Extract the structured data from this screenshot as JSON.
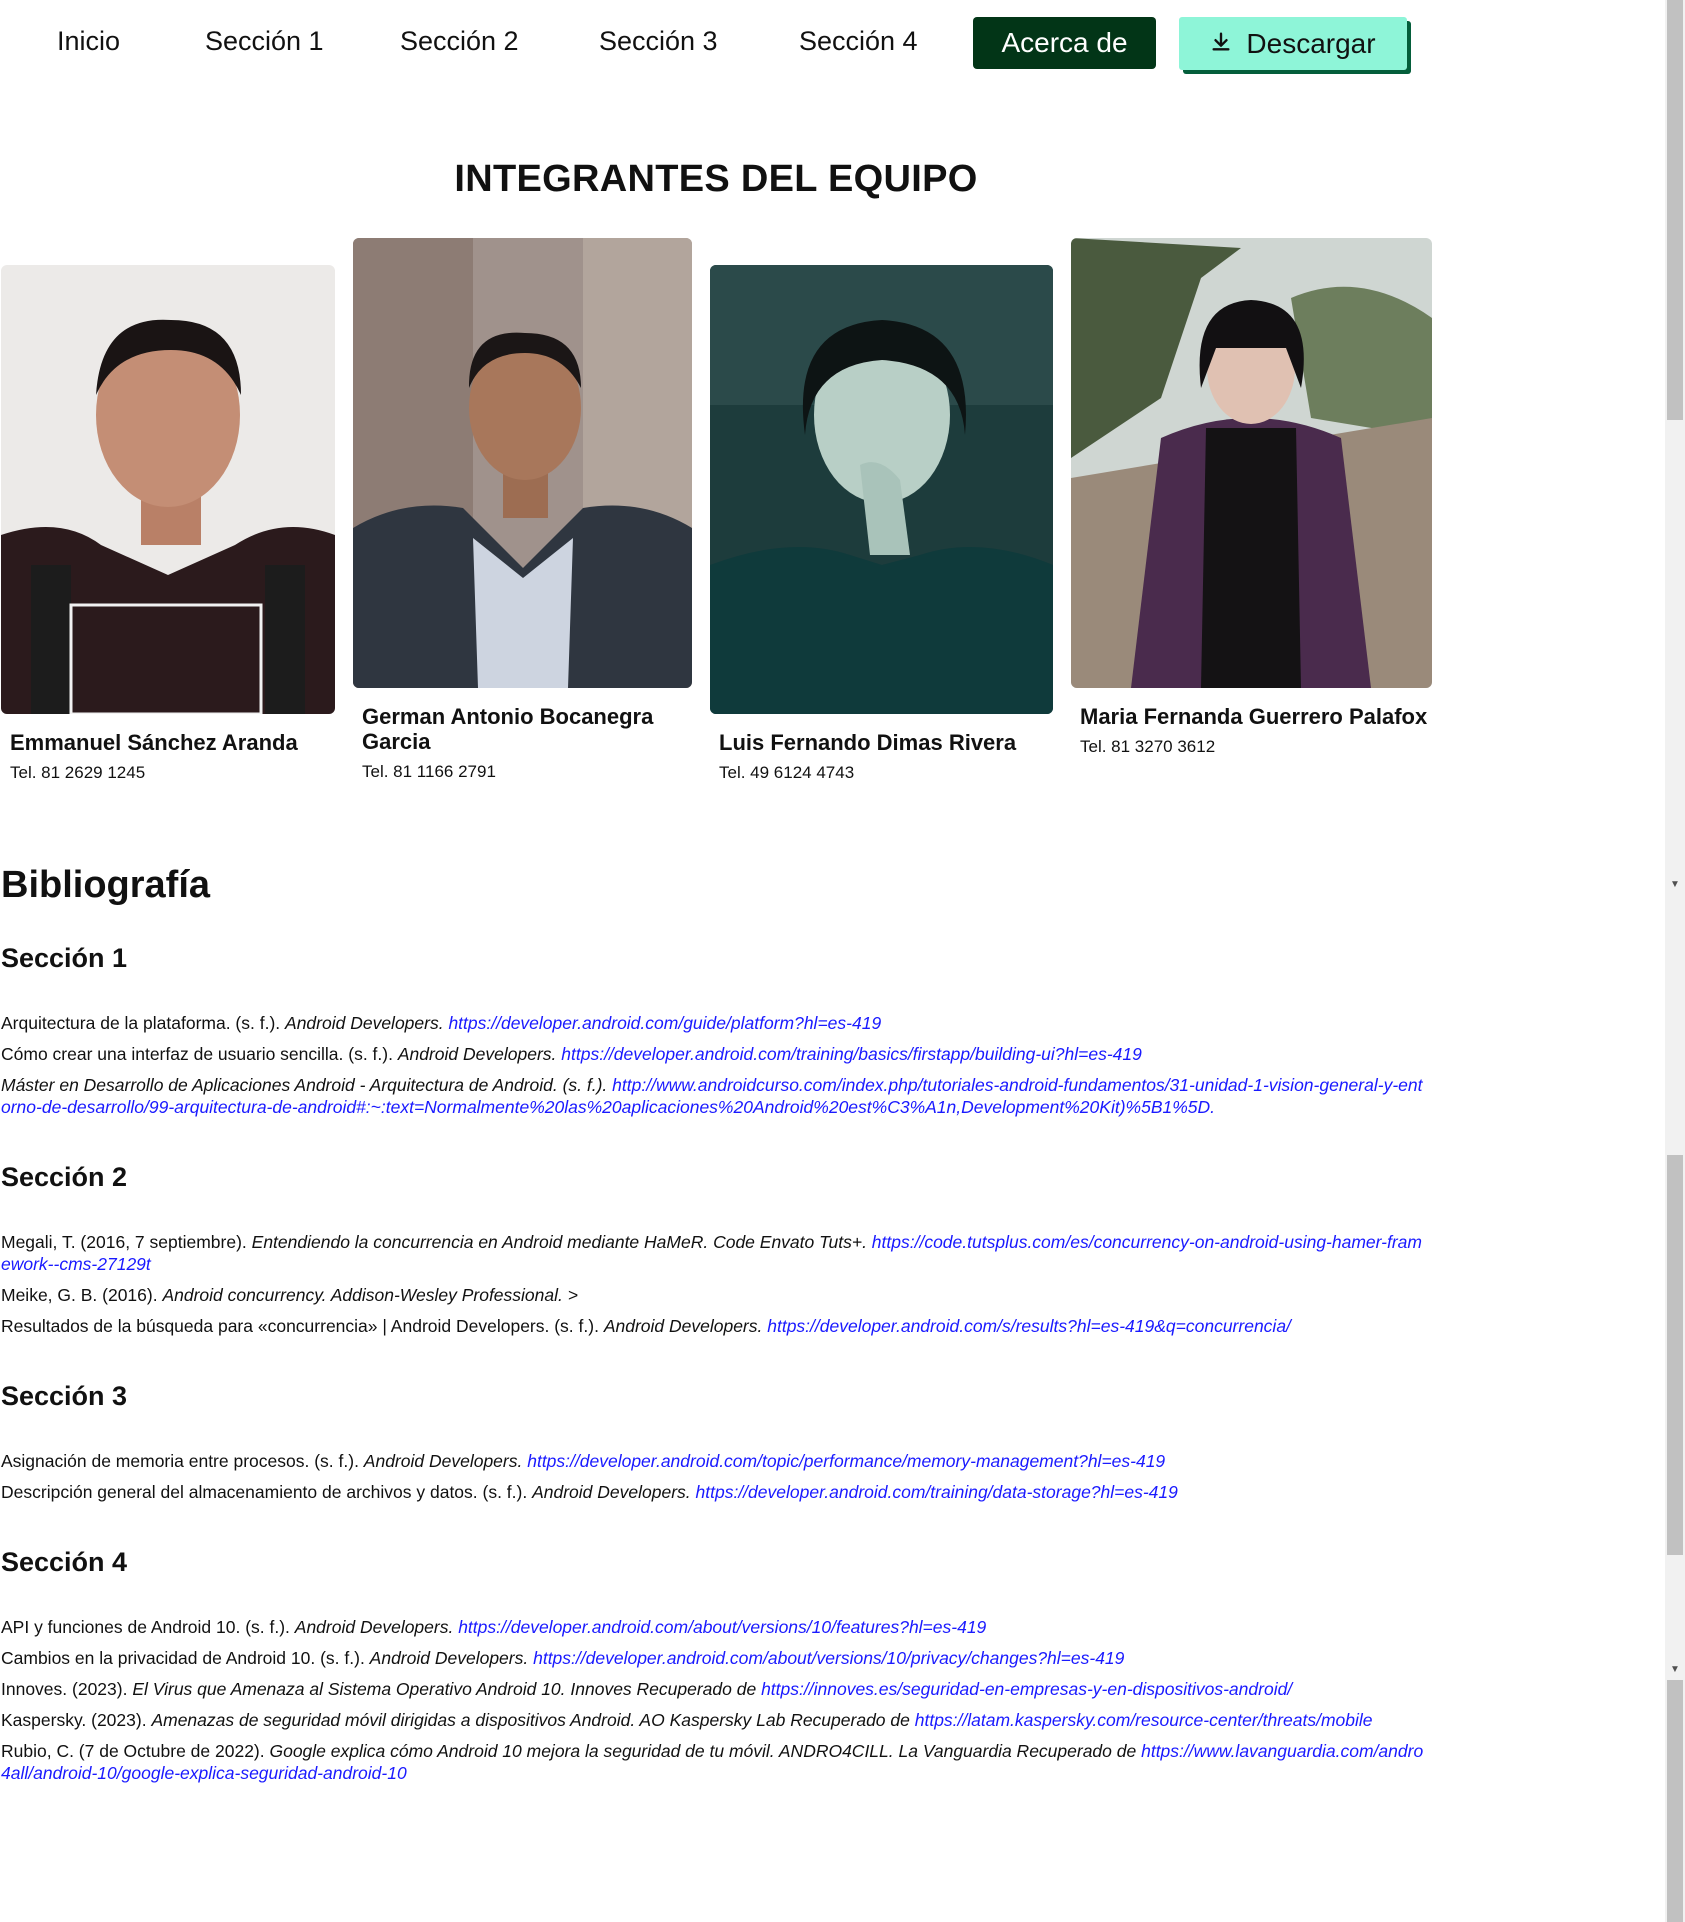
{
  "nav": {
    "links": [
      "Inicio",
      "Sección 1",
      "Sección 2",
      "Sección 3",
      "Sección 4"
    ],
    "about": "Acerca de",
    "download": "Descargar"
  },
  "team": {
    "title": "INTEGRANTES DEL EQUIPO",
    "members": [
      {
        "name": "Emmanuel Sánchez Aranda",
        "tel": "Tel. 81 2629 1245"
      },
      {
        "name": "German Antonio Bocanegra Garcia",
        "tel": "Tel. 81 1166 2791"
      },
      {
        "name": "Luis Fernando Dimas Rivera",
        "tel": "Tel. 49 6124 4743"
      },
      {
        "name": "Maria Fernanda Guerrero Palafox",
        "tel": "Tel. 81 3270 3612"
      }
    ]
  },
  "biblio": {
    "title": "Bibliografía",
    "sections": [
      {
        "heading": "Sección 1",
        "refs": [
          {
            "text": "Arquitectura de la plataforma. (s. f.). ",
            "italic": "Android Developers. ",
            "link": "https://developer.android.com/guide/platform?hl=es-419"
          },
          {
            "text": "Cómo crear una interfaz de usuario sencilla. (s. f.). ",
            "italic": "Android Developers. ",
            "link": "https://developer.android.com/training/basics/firstapp/building-ui?hl=es-419"
          },
          {
            "text": "",
            "italic": "Máster en Desarrollo de Aplicaciones Android - Arquitectura de Android. (s. f.). ",
            "link": "http://www.androidcurso.com/index.php/tutoriales-android-fundamentos/31-unidad-1-vision-general-y-entorno-de-desarrollo/99-arquitectura-de-android#:~:text=Normalmente%20las%20aplicaciones%20Android%20est%C3%A1n,Development%20Kit)%5B1%5D."
          }
        ]
      },
      {
        "heading": "Sección 2",
        "refs": [
          {
            "text": "Megali, T. (2016, 7 septiembre). ",
            "italic": "Entendiendo la concurrencia en Android mediante HaMeR. Code Envato Tuts+. ",
            "link": "https://code.tutsplus.com/es/concurrency-on-android-using-hamer-framework--cms-27129t"
          },
          {
            "text": "Meike, G. B. (2016). ",
            "italic": "Android concurrency. Addison-Wesley Professional. >",
            "link": ""
          },
          {
            "text": "Resultados de la búsqueda para «concurrencia» | Android Developers. (s. f.). ",
            "italic": "Android Developers. ",
            "link": "https://developer.android.com/s/results?hl=es-419&q=concurrencia/"
          }
        ]
      },
      {
        "heading": "Sección 3",
        "refs": [
          {
            "text": "Asignación de memoria entre procesos. (s. f.). ",
            "italic": "Android Developers. ",
            "link": "https://developer.android.com/topic/performance/memory-management?hl=es-419"
          },
          {
            "text": "Descripción general del almacenamiento de archivos y datos. (s. f.). ",
            "italic": "Android Developers. ",
            "link": "https://developer.android.com/training/data-storage?hl=es-419"
          }
        ]
      },
      {
        "heading": "Sección 4",
        "refs": [
          {
            "text": "API y funciones de Android 10. (s. f.). ",
            "italic": "Android Developers. ",
            "link": "https://developer.android.com/about/versions/10/features?hl=es-419"
          },
          {
            "text": "Cambios en la privacidad de Android 10. (s. f.). ",
            "italic": "Android Developers. ",
            "link": "https://developer.android.com/about/versions/10/privacy/changes?hl=es-419"
          },
          {
            "text": "Innoves. (2023). ",
            "italic": "El Virus que Amenaza al Sistema Operativo Android 10. Innoves Recuperado de ",
            "link": "https://innoves.es/seguridad-en-empresas-y-en-dispositivos-android/"
          },
          {
            "text": "Kaspersky. (2023). ",
            "italic": "Amenazas de seguridad móvil dirigidas a dispositivos Android. AO Kaspersky Lab Recuperado de ",
            "link": "https://latam.kaspersky.com/resource-center/threats/mobile"
          },
          {
            "text": "Rubio, C. (7 de Octubre de 2022). ",
            "italic": "Google explica cómo Android 10 mejora la seguridad de tu móvil. ANDRO4CILL. La Vanguardia Recuperado de ",
            "link": "https://www.lavanguardia.com/andro4all/android-10/google-explica-seguridad-android-10"
          }
        ]
      }
    ]
  },
  "colors": {
    "about_bg": "#023517",
    "download_bg": "#8ef5d8",
    "download_shadow": "#045e3b",
    "link": "#1a1aff"
  },
  "icons": {
    "download": "download-icon"
  }
}
